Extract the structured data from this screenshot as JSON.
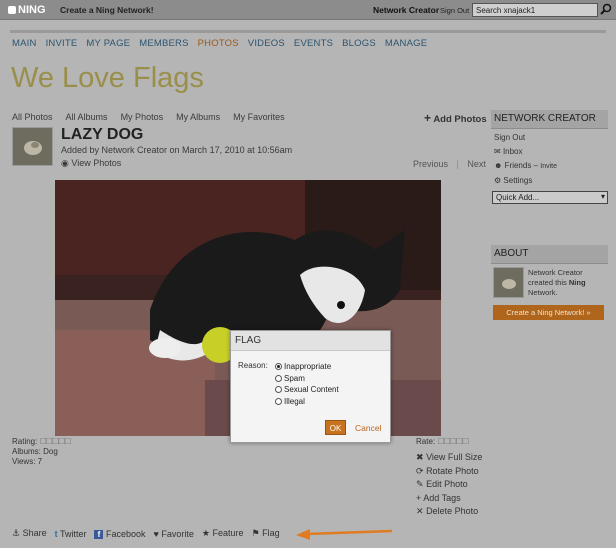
{
  "topbar": {
    "logo": "NING",
    "create_link": "Create a Ning Network!",
    "network_creator": "Network Creator",
    "sign_out": "Sign Out",
    "search_value": "Search xnajack1"
  },
  "nav": [
    "MAIN",
    "INVITE",
    "MY PAGE",
    "MEMBERS",
    "PHOTOS",
    "VIDEOS",
    "EVENTS",
    "BLOGS",
    "MANAGE"
  ],
  "nav_active": "PHOTOS",
  "site_title": "We Love Flags",
  "tabs": [
    "All Photos",
    "All Albums",
    "My Photos",
    "My Albums",
    "My Favorites"
  ],
  "add_photos": "Add Photos",
  "photo": {
    "title": "LAZY DOG",
    "byline": "Added by Network Creator on March 17, 2010 at 10:56am",
    "view_photos": "View Photos",
    "previous": "Previous",
    "next": "Next"
  },
  "meta": {
    "rating_label": "Rating:",
    "albums_label": "Albums:",
    "albums_value": "Dog",
    "views_label": "Views:",
    "views_value": "7",
    "rate_label": "Rate:"
  },
  "actions": [
    "View Full Size",
    "Rotate Photo",
    "Edit Photo",
    "Add Tags",
    "Delete Photo"
  ],
  "bottom": [
    "Share",
    "Twitter",
    "Facebook",
    "Favorite",
    "Feature",
    "Flag"
  ],
  "sidebar": {
    "heading": "NETWORK CREATOR",
    "sign_out": "Sign Out",
    "inbox": "Inbox",
    "friends": "Friends",
    "invite": "Invite",
    "settings": "Settings",
    "quick_add": "Quick Add...",
    "about_heading": "ABOUT",
    "about_name": "Network Creator",
    "about_mid": "created this",
    "about_ning": "Ning",
    "about_network": "Network.",
    "create_button": "Create a Ning Network! »"
  },
  "dialog": {
    "title": "FLAG",
    "reason_label": "Reason:",
    "options": [
      "Inappropriate",
      "Spam",
      "Sexual Content",
      "Illegal"
    ],
    "selected": 0,
    "ok": "OK",
    "cancel": "Cancel"
  },
  "colors": {
    "arrow": "#e07b22",
    "nav_link": "#2c5470",
    "accent": "#c6721f"
  }
}
